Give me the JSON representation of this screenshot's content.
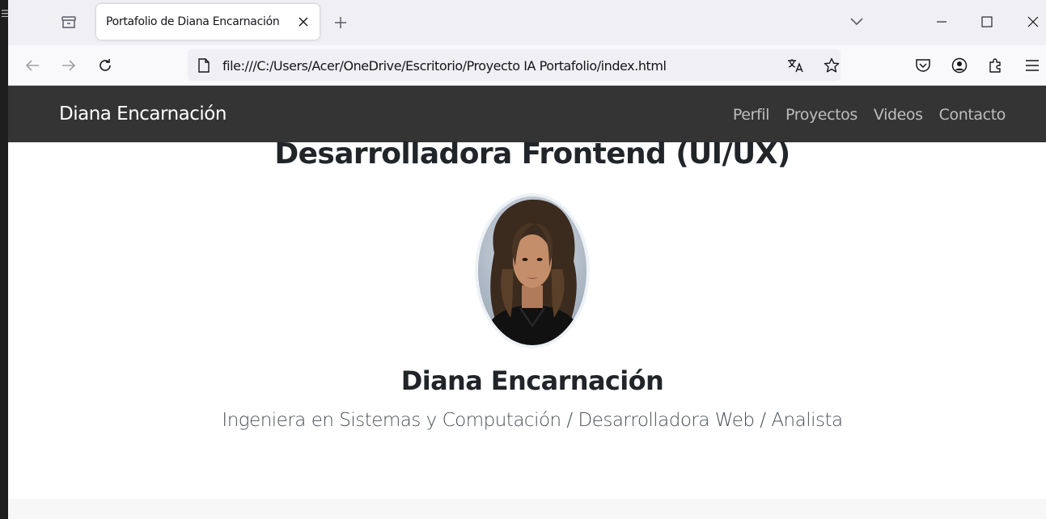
{
  "browser": {
    "tab": {
      "title": "Portafolio de Diana Encarnación"
    },
    "url": "file:///C:/Users/Acer/OneDrive/Escritorio/Proyecto IA Portafolio/index.html",
    "icons": [
      "tab-list-icon",
      "close-tab-icon",
      "new-tab-icon",
      "list-all-tabs-icon",
      "minimize-icon",
      "maximize-icon",
      "close-window-icon",
      "back-icon",
      "forward-icon",
      "reload-icon",
      "page-icon",
      "translate-icon",
      "bookmark-star-icon",
      "pocket-icon",
      "account-icon",
      "extensions-icon",
      "menu-icon"
    ]
  },
  "site": {
    "brand": "Diana Encarnación",
    "nav": [
      "Perfil",
      "Proyectos",
      "Videos",
      "Contacto"
    ],
    "hero_title": "Desarrolladora Frontend (UI/UX)",
    "name": "Diana Encarnación",
    "subtitle": "Ingeniera en Sistemas y Computación / Desarrolladora Web / Analista"
  },
  "colors": {
    "navbar_bg": "#343434",
    "nav_link": "#bdbdbd",
    "brand_text": "#ffffff",
    "tabstrip_bg": "#f0f0f4"
  }
}
